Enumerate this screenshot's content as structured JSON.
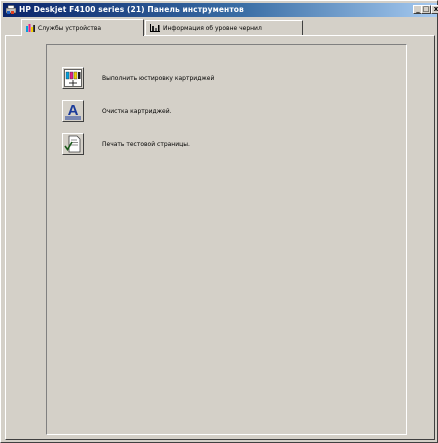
{
  "window": {
    "title": "HP Deskjet F4100 series (21) Панель инструментов",
    "controls": {
      "minimize": "_",
      "maximize": "□",
      "close": "x"
    }
  },
  "tabs": [
    {
      "label": "Службы устройства",
      "icon": "device-services-icon",
      "active": true
    },
    {
      "label": "Информация об уровне чернил",
      "icon": "ink-level-icon",
      "active": false
    }
  ],
  "actions": [
    {
      "label": "Выполнить юстировку картриджей",
      "icon": "align-cartridges-icon"
    },
    {
      "label": "Очистка картриджей.",
      "icon": "clean-cartridges-icon"
    },
    {
      "label": "Печать тестовой страницы.",
      "icon": "print-test-page-icon"
    }
  ],
  "colors": {
    "titlebar_start": "#0a246a",
    "titlebar_end": "#a6caf0",
    "face": "#d4d0c8"
  }
}
